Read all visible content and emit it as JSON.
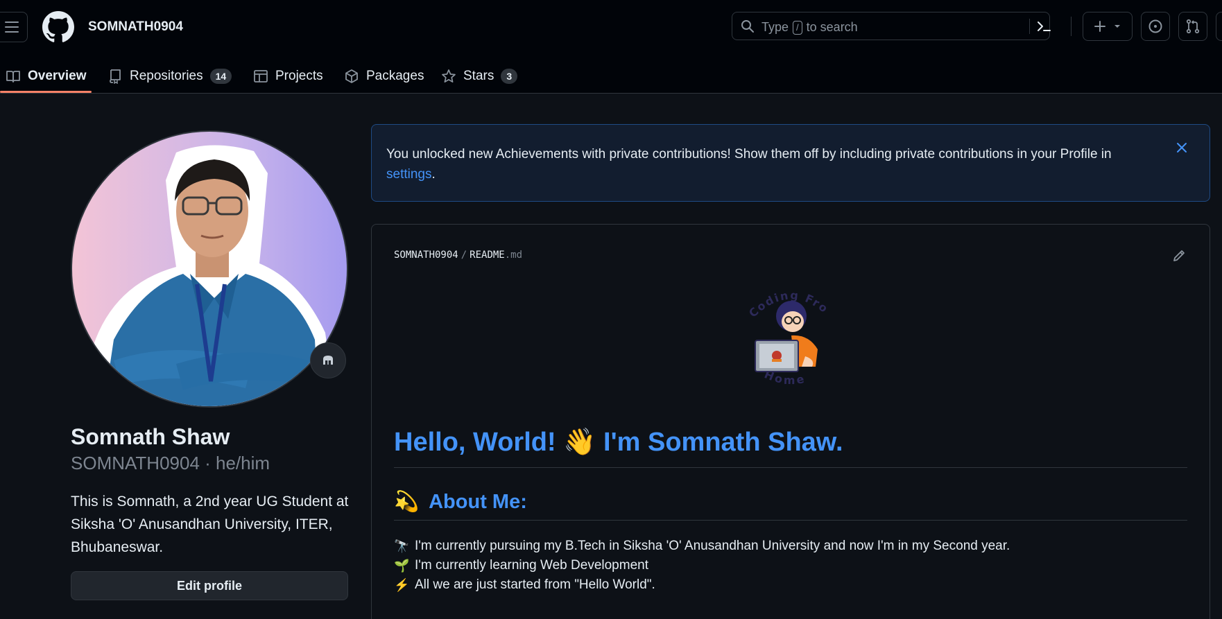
{
  "header": {
    "username": "SOMNATH0904",
    "search": {
      "prefix": "Type",
      "key": "/",
      "suffix": "to search"
    }
  },
  "tabs": [
    {
      "label": "Overview",
      "icon": "book-icon",
      "active": true
    },
    {
      "label": "Repositories",
      "icon": "repo-icon",
      "count": "14"
    },
    {
      "label": "Projects",
      "icon": "table-icon"
    },
    {
      "label": "Packages",
      "icon": "package-icon"
    },
    {
      "label": "Stars",
      "icon": "star-icon",
      "count": "3"
    }
  ],
  "profile": {
    "name": "Somnath Shaw",
    "login": "SOMNATH0904 · he/him",
    "bio": "This is Somnath, a 2nd year UG Student at Siksha 'O' Anusandhan University, ITER, Bhubaneswar.",
    "edit_label": "Edit profile"
  },
  "flash": {
    "text": "You unlocked new Achievements with private contributions! Show them off by including private contributions in your Profile in",
    "link": "settings",
    "tail": "."
  },
  "readme": {
    "owner": "SOMNATH0904",
    "file": "README",
    "ext": ".md",
    "illustration_text_top": "Coding From",
    "illustration_text_bottom": "Home",
    "heading": "Hello, World! 👋 I'm Somnath Shaw.",
    "about_emoji": "💫",
    "about_title": "About Me:",
    "items": [
      {
        "emoji": "🔭",
        "text": "I'm currently pursuing my B.Tech in Siksha 'O' Anusandhan University and now I'm in my Second year."
      },
      {
        "emoji": "🌱",
        "text": "I'm currently learning Web Development"
      },
      {
        "emoji": "⚡",
        "text": "All we are just started from \"Hello World\"."
      }
    ]
  },
  "colors": {
    "accent_link": "#4493f8",
    "tab_underline": "#f78166",
    "background": "#0d1117"
  }
}
